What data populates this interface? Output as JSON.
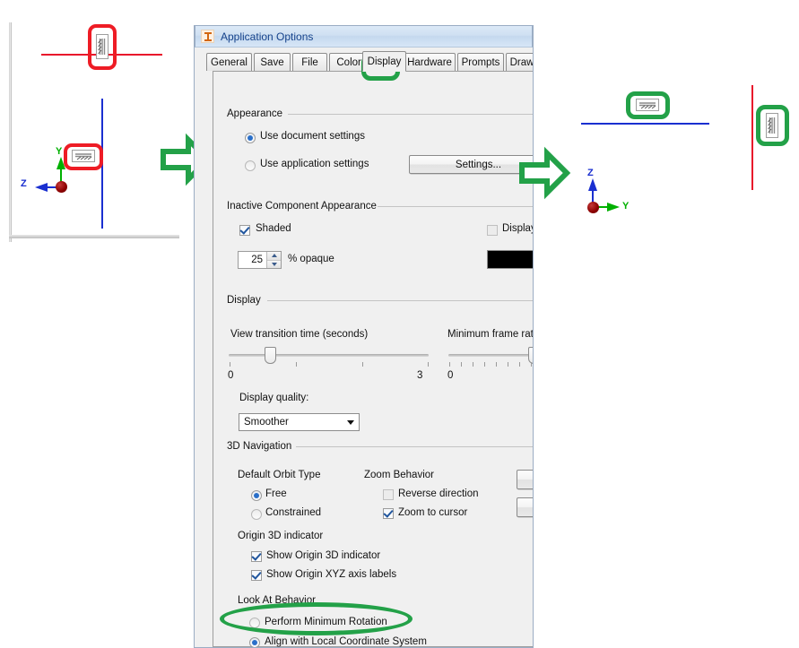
{
  "window": {
    "title": "Application Options",
    "icon": "inventor-logo-icon"
  },
  "tabs": [
    {
      "label": "General",
      "selected": false
    },
    {
      "label": "Save",
      "selected": false
    },
    {
      "label": "File",
      "selected": false
    },
    {
      "label": "Colors",
      "selected": false
    },
    {
      "label": "Display",
      "selected": true
    },
    {
      "label": "Hardware",
      "selected": false
    },
    {
      "label": "Prompts",
      "selected": false
    },
    {
      "label": "Drawin",
      "selected": false
    }
  ],
  "groups": {
    "appearance": "Appearance",
    "inactive_component": "Inactive Component Appearance",
    "display": "Display",
    "navigation": "3D Navigation"
  },
  "appearance": {
    "use_document_settings": "Use document settings",
    "use_document_settings_checked": true,
    "use_application_settings": "Use application settings",
    "use_application_settings_checked": false,
    "settings_button": "Settings..."
  },
  "inactive": {
    "shaded": "Shaded",
    "shaded_checked": true,
    "display_edges": "Display edg",
    "display_edges_checked": false,
    "opaque_value": "25",
    "opaque_label": "% opaque",
    "color_swatch": "#000000"
  },
  "display": {
    "view_transition_label": "View transition time (seconds)",
    "view_transition_min": "0",
    "view_transition_max": "3",
    "view_transition_value": 0.55,
    "frame_rate_label": "Minimum frame rate (H",
    "frame_rate_min": "0",
    "frame_rate_value": 0.87,
    "quality_label": "Display quality:",
    "quality_value": "Smoother"
  },
  "navigation": {
    "orbit_title": "Default Orbit Type",
    "orbit_free": "Free",
    "orbit_free_checked": true,
    "orbit_constrained": "Constrained",
    "orbit_constrained_checked": false,
    "zoom_title": "Zoom Behavior",
    "reverse_direction": "Reverse direction",
    "reverse_direction_checked": false,
    "zoom_to_cursor": "Zoom to cursor",
    "zoom_to_cursor_checked": true,
    "origin_title": "Origin 3D indicator",
    "show_origin_indicator": "Show Origin 3D indicator",
    "show_origin_indicator_checked": true,
    "show_origin_labels": "Show Origin XYZ axis labels",
    "show_origin_labels_checked": true,
    "lookat_title": "Look At Behavior",
    "perform_minimum_rotation": "Perform Minimum Rotation",
    "perform_minimum_rotation_checked": false,
    "align_local_coords": "Align with Local Coordinate System",
    "align_local_coords_checked": true
  },
  "left_viewport": {
    "axis_y_label": "Y",
    "axis_z_label": "Z",
    "red_line_color": "#e8122b",
    "blue_line_color": "#1a2fd0",
    "y_axis_color": "#00b000",
    "z_axis_color": "#1a2fd0",
    "origin_color": "#8b0000"
  },
  "right_viewport": {
    "axis_z_label": "Z",
    "axis_y_label": "Y",
    "red_line_color": "#e8122b",
    "blue_line_color": "#1a2fd0",
    "y_axis_color": "#00b000",
    "z_axis_color": "#1a2fd0",
    "origin_color": "#8b0000"
  },
  "annotations": {
    "highlight_red": "#ee1c25",
    "highlight_green": "#23a148",
    "arrow_color": "#23a148"
  }
}
